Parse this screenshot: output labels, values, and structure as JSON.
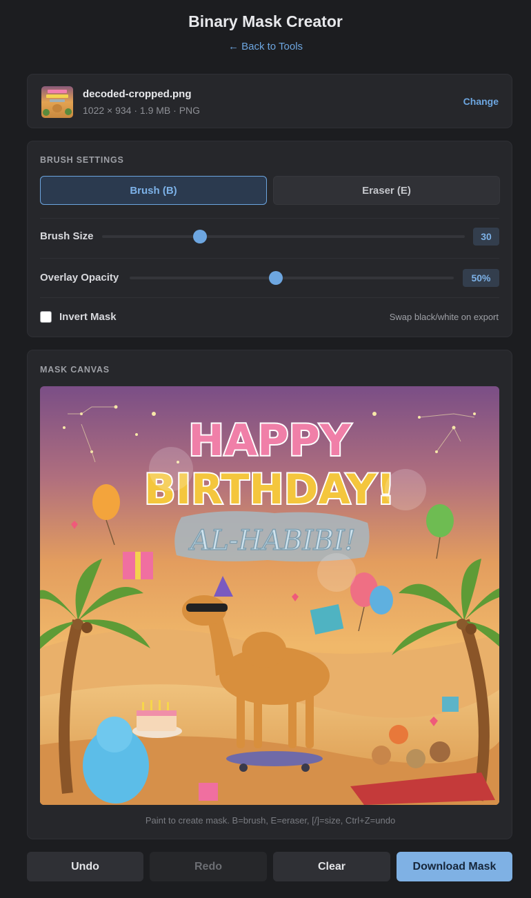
{
  "header": {
    "title": "Binary Mask Creator",
    "back_link": "← Back to Tools"
  },
  "file": {
    "name": "decoded-cropped.png",
    "meta": "1022 × 934 · 1.9 MB · PNG",
    "change_label": "Change"
  },
  "brush_settings": {
    "section_label": "BRUSH SETTINGS",
    "brush_label": "Brush (B)",
    "eraser_label": "Eraser (E)",
    "active_mode": "brush",
    "brush_size_label": "Brush Size",
    "brush_size_value": "30",
    "brush_size_fraction": 0.27,
    "opacity_label": "Overlay Opacity",
    "opacity_value": "50%",
    "opacity_fraction": 0.45,
    "invert_label": "Invert Mask",
    "invert_checked": false,
    "invert_hint": "Swap black/white on export"
  },
  "canvas": {
    "section_label": "MASK CANVAS",
    "image_text_line1": "HAPPY",
    "image_text_line2": "BIRTHDAY!",
    "image_text_line3": "AL-HABIBI!",
    "hint": "Paint to create mask. B=brush, E=eraser, [/]=size, Ctrl+Z=undo"
  },
  "actions": {
    "undo": "Undo",
    "redo": "Redo",
    "clear": "Clear",
    "download": "Download Mask"
  },
  "colors": {
    "accent": "#6da6e0",
    "background": "#1c1d20",
    "card": "#26272b"
  }
}
